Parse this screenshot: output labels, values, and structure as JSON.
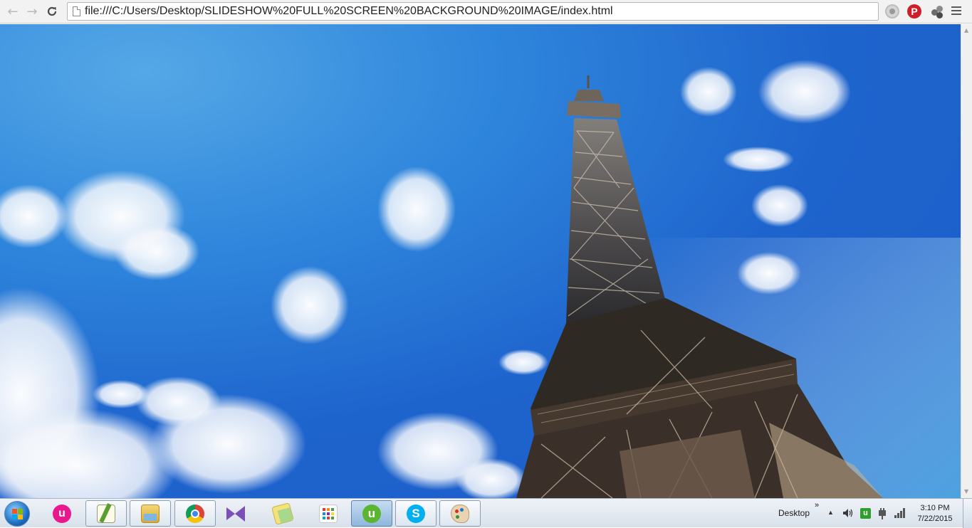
{
  "browser": {
    "url": "file:///C:/Users/Desktop/SLIDESHOW%20FULL%20SCREEN%20BACKGROUND%20IMAGE/index.html",
    "back_icon": "arrow-left-icon",
    "forward_icon": "arrow-right-icon",
    "reload_icon": "reload-icon",
    "menu_icon": "hamburger-menu-icon",
    "extensions": [
      "gray-circle-extension-icon",
      "pinterest-icon",
      "dots-extension-icon"
    ],
    "pinterest_glyph": "P"
  },
  "page": {
    "background_image": "eiffel-tower-blue-sky",
    "sky_color": "#1e64cd"
  },
  "taskbar": {
    "start_icon": "windows-start-orb-icon",
    "apps": [
      "app-pink-u-icon",
      "notepad-plus-plus-icon",
      "file-manager-icon",
      "chrome-icon",
      "visual-studio-icon",
      "sticky-notes-icon",
      "tiles-app-icon",
      "utorrent-icon",
      "skype-icon",
      "paint-icon"
    ],
    "desktop_label": "Desktop",
    "desktop_chevron": "»",
    "tray_icons": [
      "show-hidden-icons-icon",
      "volume-icon",
      "utorrent-tray-icon",
      "network-plug-icon",
      "signal-bars-icon"
    ],
    "time": "3:10 PM",
    "date": "7/22/2015"
  }
}
